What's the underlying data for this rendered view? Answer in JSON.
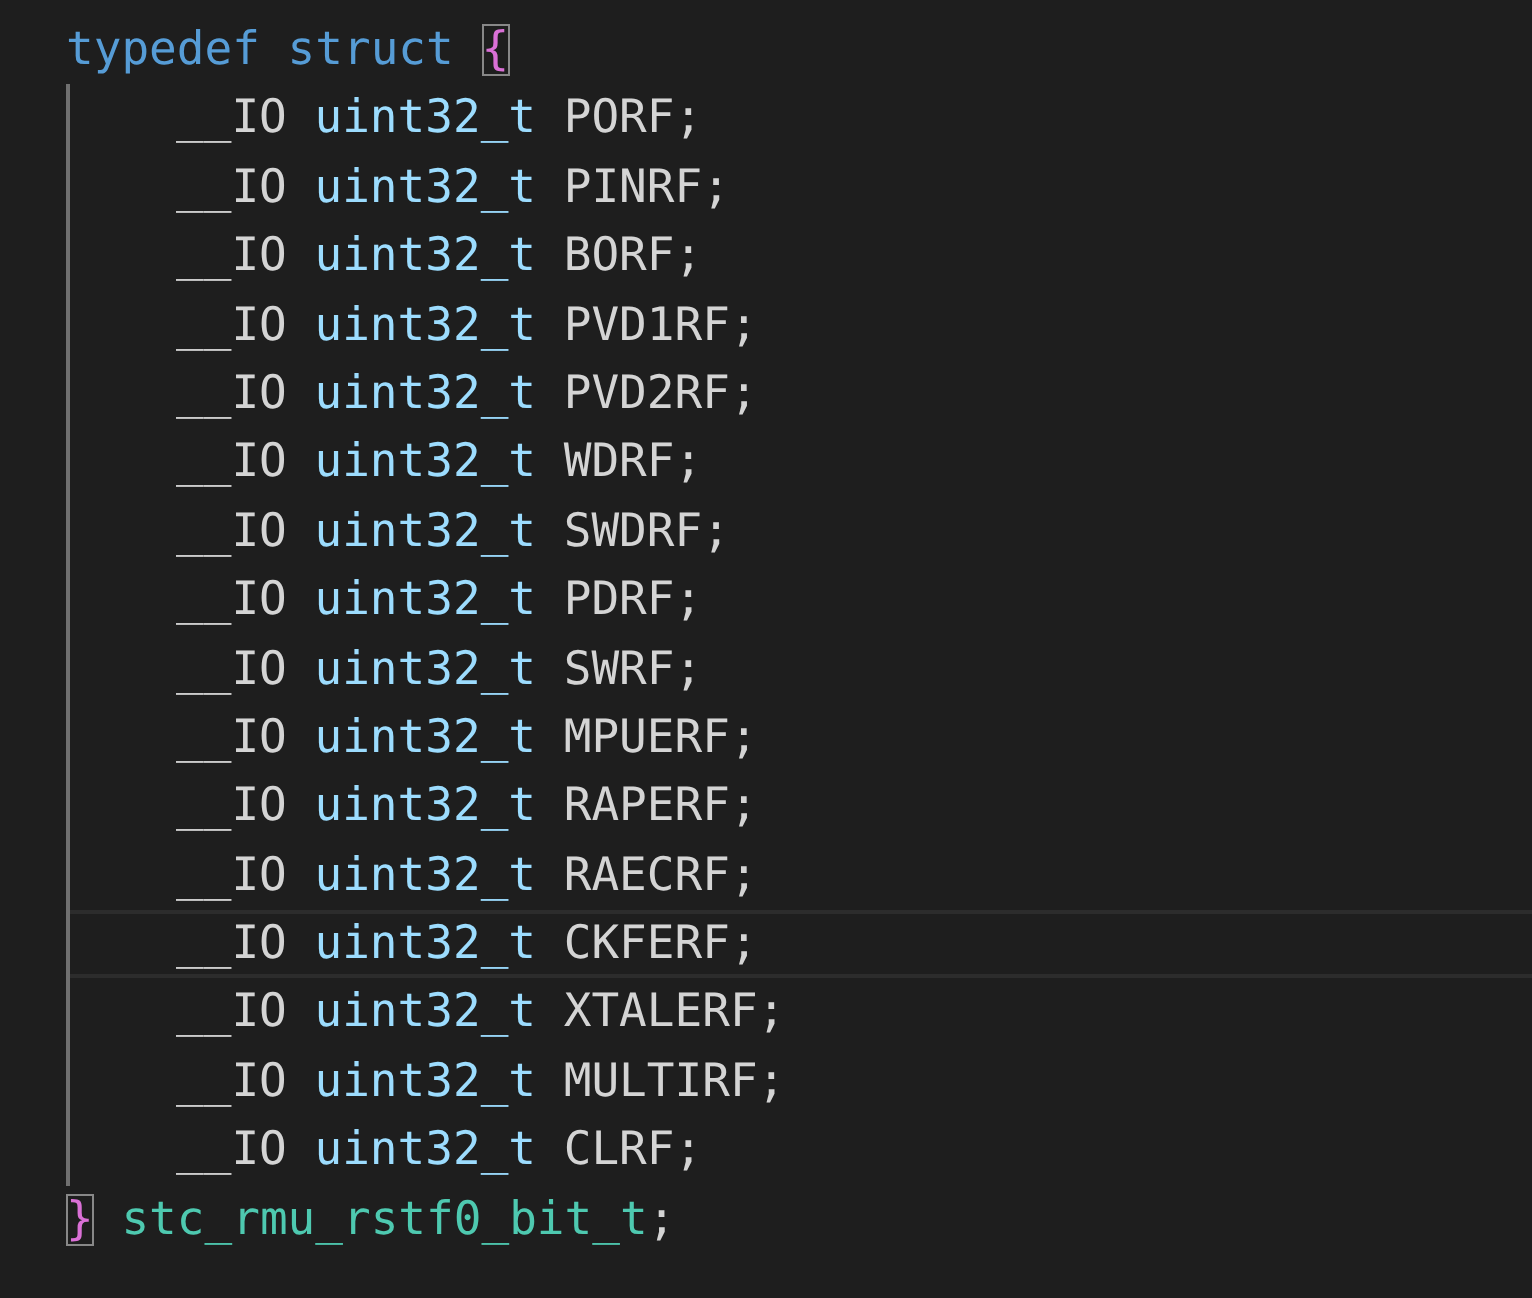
{
  "code": [
    {
      "current": false,
      "tokens": [
        {
          "kind": "keyword",
          "text": "typedef"
        },
        {
          "kind": "keyword",
          "text": "struct"
        },
        {
          "kind": "bracket_match",
          "text": "{"
        }
      ],
      "children": [
        {
          "current": false,
          "tokens": [
            {
              "kind": "macro",
              "text": "__IO"
            },
            {
              "kind": "type",
              "text": "uint32_t"
            },
            {
              "kind": "plain",
              "text": "PORF"
            },
            {
              "kind": "punct",
              "text": ";"
            }
          ]
        },
        {
          "current": false,
          "tokens": [
            {
              "kind": "macro",
              "text": "__IO"
            },
            {
              "kind": "type",
              "text": "uint32_t"
            },
            {
              "kind": "plain",
              "text": "PINRF"
            },
            {
              "kind": "punct",
              "text": ";"
            }
          ]
        },
        {
          "current": false,
          "tokens": [
            {
              "kind": "macro",
              "text": "__IO"
            },
            {
              "kind": "type",
              "text": "uint32_t"
            },
            {
              "kind": "plain",
              "text": "BORF"
            },
            {
              "kind": "punct",
              "text": ";"
            }
          ]
        },
        {
          "current": false,
          "tokens": [
            {
              "kind": "macro",
              "text": "__IO"
            },
            {
              "kind": "type",
              "text": "uint32_t"
            },
            {
              "kind": "plain",
              "text": "PVD1RF"
            },
            {
              "kind": "punct",
              "text": ";"
            }
          ]
        },
        {
          "current": false,
          "tokens": [
            {
              "kind": "macro",
              "text": "__IO"
            },
            {
              "kind": "type",
              "text": "uint32_t"
            },
            {
              "kind": "plain",
              "text": "PVD2RF"
            },
            {
              "kind": "punct",
              "text": ";"
            }
          ]
        },
        {
          "current": false,
          "tokens": [
            {
              "kind": "macro",
              "text": "__IO"
            },
            {
              "kind": "type",
              "text": "uint32_t"
            },
            {
              "kind": "plain",
              "text": "WDRF"
            },
            {
              "kind": "punct",
              "text": ";"
            }
          ]
        },
        {
          "current": false,
          "tokens": [
            {
              "kind": "macro",
              "text": "__IO"
            },
            {
              "kind": "type",
              "text": "uint32_t"
            },
            {
              "kind": "plain",
              "text": "SWDRF"
            },
            {
              "kind": "punct",
              "text": ";"
            }
          ]
        },
        {
          "current": false,
          "tokens": [
            {
              "kind": "macro",
              "text": "__IO"
            },
            {
              "kind": "type",
              "text": "uint32_t"
            },
            {
              "kind": "plain",
              "text": "PDRF"
            },
            {
              "kind": "punct",
              "text": ";"
            }
          ]
        },
        {
          "current": false,
          "tokens": [
            {
              "kind": "macro",
              "text": "__IO"
            },
            {
              "kind": "type",
              "text": "uint32_t"
            },
            {
              "kind": "plain",
              "text": "SWRF"
            },
            {
              "kind": "punct",
              "text": ";"
            }
          ]
        },
        {
          "current": false,
          "tokens": [
            {
              "kind": "macro",
              "text": "__IO"
            },
            {
              "kind": "type",
              "text": "uint32_t"
            },
            {
              "kind": "plain",
              "text": "MPUERF"
            },
            {
              "kind": "punct",
              "text": ";"
            }
          ]
        },
        {
          "current": false,
          "tokens": [
            {
              "kind": "macro",
              "text": "__IO"
            },
            {
              "kind": "type",
              "text": "uint32_t"
            },
            {
              "kind": "plain",
              "text": "RAPERF"
            },
            {
              "kind": "punct",
              "text": ";"
            }
          ]
        },
        {
          "current": false,
          "tokens": [
            {
              "kind": "macro",
              "text": "__IO"
            },
            {
              "kind": "type",
              "text": "uint32_t"
            },
            {
              "kind": "plain",
              "text": "RAECRF"
            },
            {
              "kind": "punct",
              "text": ";"
            }
          ]
        },
        {
          "current": true,
          "tokens": [
            {
              "kind": "macro",
              "text": "__IO"
            },
            {
              "kind": "type",
              "text": "uint32_t"
            },
            {
              "kind": "plain",
              "text": "CKFERF"
            },
            {
              "kind": "punct",
              "text": ";"
            }
          ]
        },
        {
          "current": false,
          "tokens": [
            {
              "kind": "macro",
              "text": "__IO"
            },
            {
              "kind": "type",
              "text": "uint32_t"
            },
            {
              "kind": "plain",
              "text": "XTALERF"
            },
            {
              "kind": "punct",
              "text": ";"
            }
          ]
        },
        {
          "current": false,
          "tokens": [
            {
              "kind": "macro",
              "text": "__IO"
            },
            {
              "kind": "type",
              "text": "uint32_t"
            },
            {
              "kind": "plain",
              "text": "MULTIRF"
            },
            {
              "kind": "punct",
              "text": ";"
            }
          ]
        },
        {
          "current": false,
          "tokens": [
            {
              "kind": "macro",
              "text": "__IO"
            },
            {
              "kind": "type",
              "text": "uint32_t"
            },
            {
              "kind": "plain",
              "text": "CLRF"
            },
            {
              "kind": "punct",
              "text": ";"
            }
          ]
        }
      ]
    },
    {
      "current": false,
      "tokens": [
        {
          "kind": "bracket_match",
          "text": "}"
        },
        {
          "kind": "struct_name",
          "text": "stc_rmu_rstf0_bit_t"
        },
        {
          "kind": "punct",
          "text": ";"
        }
      ]
    }
  ]
}
